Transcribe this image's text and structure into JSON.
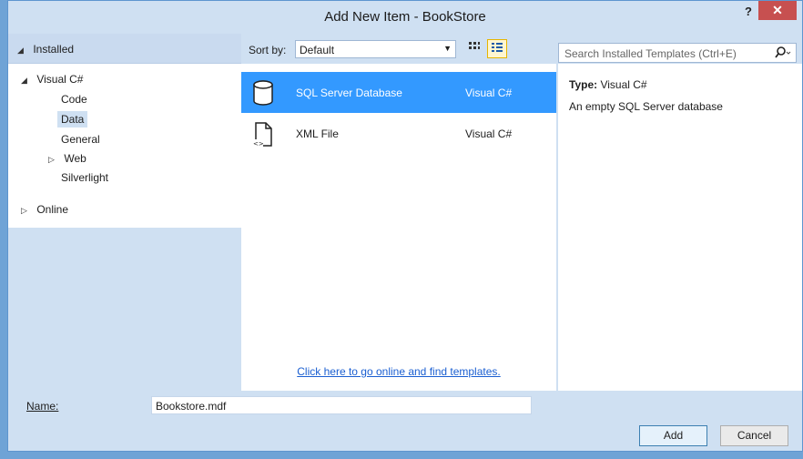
{
  "window": {
    "title": "Add New Item - BookStore",
    "help_label": "?",
    "close_label": "✕"
  },
  "left": {
    "installed_label": "Installed",
    "tree": [
      {
        "label": "Visual C#"
      },
      {
        "label": "Code"
      },
      {
        "label": "Data"
      },
      {
        "label": "General"
      },
      {
        "label": "Web"
      },
      {
        "label": "Silverlight"
      }
    ],
    "online_label": "Online"
  },
  "center": {
    "sort_label": "Sort by:",
    "sort_value": "Default",
    "items": [
      {
        "name": "SQL Server Database",
        "lang": "Visual C#",
        "icon": "database-icon"
      },
      {
        "name": "XML File",
        "lang": "Visual C#",
        "icon": "xml-file-icon"
      }
    ],
    "online_link": "Click here to go online and find templates."
  },
  "right": {
    "search_placeholder": "Search Installed Templates (Ctrl+E)",
    "type_label": "Type:",
    "type_value": "Visual C#",
    "description": "An empty SQL Server database"
  },
  "bottom": {
    "name_label": "Name:",
    "name_value": "Bookstore.mdf",
    "add_label": "Add",
    "cancel_label": "Cancel"
  },
  "colors": {
    "selection": "#3399ff",
    "link": "#1b5fd1",
    "close": "#c75050"
  }
}
